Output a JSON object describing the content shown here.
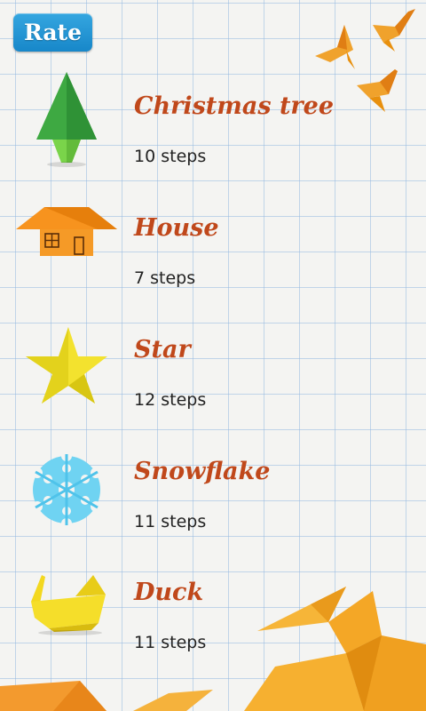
{
  "header": {
    "rate_label": "Rate"
  },
  "decorations": {
    "birds_icon": "origami-birds-icon",
    "crane_icon": "origami-crane-icon",
    "paper_icon": "origami-paper-icon"
  },
  "items": [
    {
      "title": "Christmas tree",
      "steps": "10 steps",
      "icon": "christmas-tree-icon"
    },
    {
      "title": "House",
      "steps": "7 steps",
      "icon": "house-icon"
    },
    {
      "title": "Star",
      "steps": "12 steps",
      "icon": "star-icon"
    },
    {
      "title": "Snowflake",
      "steps": "11 steps",
      "icon": "snowflake-icon"
    },
    {
      "title": "Duck",
      "steps": "11 steps",
      "icon": "duck-icon"
    }
  ],
  "colors": {
    "title_text": "#c0481b",
    "rate_button": "#1f92d2",
    "grid_line": "#96b9e1",
    "paper_background": "#f4f4f2"
  }
}
